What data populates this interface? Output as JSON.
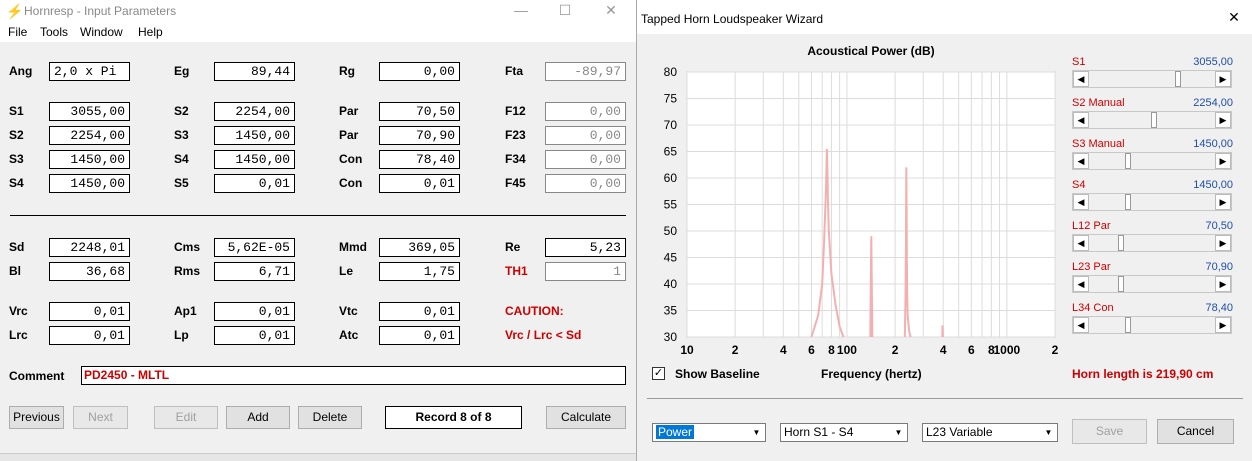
{
  "left_window": {
    "title": "Hornresp - Input Parameters",
    "controls": {
      "minimize": "—",
      "maximize": "☐",
      "close": "✕"
    },
    "menu": [
      "File",
      "Tools",
      "Window",
      "Help"
    ],
    "params": {
      "Ang": {
        "label": "Ang",
        "value": "2,0 x Pi"
      },
      "Eg": {
        "label": "Eg",
        "value": "89,44"
      },
      "Rg": {
        "label": "Rg",
        "value": "0,00"
      },
      "Fta": {
        "label": "Fta",
        "value": "-89,97"
      },
      "S1": {
        "label": "S1",
        "value": "3055,00"
      },
      "S2a": {
        "label": "S2",
        "value": "2254,00"
      },
      "Par1": {
        "label": "Par",
        "value": "70,50"
      },
      "F12": {
        "label": "F12",
        "value": "0,00"
      },
      "S2": {
        "label": "S2",
        "value": "2254,00"
      },
      "S3a": {
        "label": "S3",
        "value": "1450,00"
      },
      "Par2": {
        "label": "Par",
        "value": "70,90"
      },
      "F23": {
        "label": "F23",
        "value": "0,00"
      },
      "S3": {
        "label": "S3",
        "value": "1450,00"
      },
      "S4a": {
        "label": "S4",
        "value": "1450,00"
      },
      "Con1": {
        "label": "Con",
        "value": "78,40"
      },
      "F34": {
        "label": "F34",
        "value": "0,00"
      },
      "S4": {
        "label": "S4",
        "value": "1450,00"
      },
      "S5": {
        "label": "S5",
        "value": "0,01"
      },
      "Con2": {
        "label": "Con",
        "value": "0,01"
      },
      "F45": {
        "label": "F45",
        "value": "0,00"
      },
      "Sd": {
        "label": "Sd",
        "value": "2248,01"
      },
      "Cms": {
        "label": "Cms",
        "value": "5,62E-05"
      },
      "Mmd": {
        "label": "Mmd",
        "value": "369,05"
      },
      "Re": {
        "label": "Re",
        "value": "5,23"
      },
      "Bl": {
        "label": "Bl",
        "value": "36,68"
      },
      "Rms": {
        "label": "Rms",
        "value": "6,71"
      },
      "Le": {
        "label": "Le",
        "value": "1,75"
      },
      "TH1": {
        "label": "TH1",
        "value": "1"
      },
      "Vrc": {
        "label": "Vrc",
        "value": "0,01"
      },
      "Ap1": {
        "label": "Ap1",
        "value": "0,01"
      },
      "Vtc": {
        "label": "Vtc",
        "value": "0,01"
      },
      "Lrc": {
        "label": "Lrc",
        "value": "0,01"
      },
      "Lp": {
        "label": "Lp",
        "value": "0,01"
      },
      "Atc": {
        "label": "Atc",
        "value": "0,01"
      }
    },
    "caution": "CAUTION:",
    "caution_detail": "Vrc / Lrc < Sd",
    "comment_label": "Comment",
    "comment_value": "PD2450 - MLTL",
    "buttons": {
      "previous": "Previous",
      "next": "Next",
      "edit": "Edit",
      "add": "Add",
      "delete": "Delete",
      "record": "Record 8 of 8",
      "calculate": "Calculate"
    }
  },
  "right_window": {
    "title": "Tapped Horn Loudspeaker Wizard",
    "close": "✕",
    "chart_data": {
      "type": "line",
      "title": "Acoustical Power (dB)",
      "xlabel": "Frequency (hertz)",
      "ylabel": "",
      "x_scale": "log",
      "xlim": [
        10,
        2000
      ],
      "ylim": [
        30,
        80
      ],
      "grid": true,
      "x_ticks": [
        "10",
        "2",
        "4",
        "6",
        "8",
        "100",
        "2",
        "4",
        "6",
        "8",
        "1000",
        "2"
      ],
      "y_ticks": [
        "80",
        "75",
        "70",
        "65",
        "60",
        "55",
        "50",
        "45",
        "40",
        "35",
        "30"
      ],
      "series": [
        {
          "color": "#f4b0b0",
          "x": [
            60,
            66,
            70,
            72,
            74,
            75,
            75.5,
            76,
            77,
            80,
            85,
            90,
            95,
            140,
            141,
            142,
            143,
            144,
            230,
            232,
            234,
            235,
            236,
            237,
            238,
            240,
            245,
            250,
            395,
            396,
            397,
            398
          ],
          "y": [
            30,
            34,
            40,
            48,
            58,
            65.5,
            62,
            56,
            50,
            42,
            36,
            32,
            30,
            30,
            40,
            49,
            40,
            30,
            30,
            36,
            48,
            62,
            55,
            44,
            38,
            34,
            31,
            30,
            30,
            32,
            32,
            30
          ]
        }
      ]
    },
    "show_baseline": "Show Baseline",
    "frequency_label": "Frequency (hertz)",
    "horn_length": "Horn length is 219,90 cm",
    "sliders": [
      {
        "label": "S1",
        "value": "3055,00",
        "pos": 0.72
      },
      {
        "label": "S2  Manual",
        "value": "2254,00",
        "pos": 0.52
      },
      {
        "label": "S3  Manual",
        "value": "1450,00",
        "pos": 0.3
      },
      {
        "label": "S4",
        "value": "1450,00",
        "pos": 0.3
      },
      {
        "label": "L12  Par",
        "value": "70,50",
        "pos": 0.24
      },
      {
        "label": "L23  Par",
        "value": "70,90",
        "pos": 0.24
      },
      {
        "label": "L34  Con",
        "value": "78,40",
        "pos": 0.3
      }
    ],
    "combos": {
      "power": "Power",
      "horn": "Horn S1 - S4",
      "l23": "L23 Variable"
    },
    "buttons": {
      "save": "Save",
      "cancel": "Cancel"
    }
  }
}
